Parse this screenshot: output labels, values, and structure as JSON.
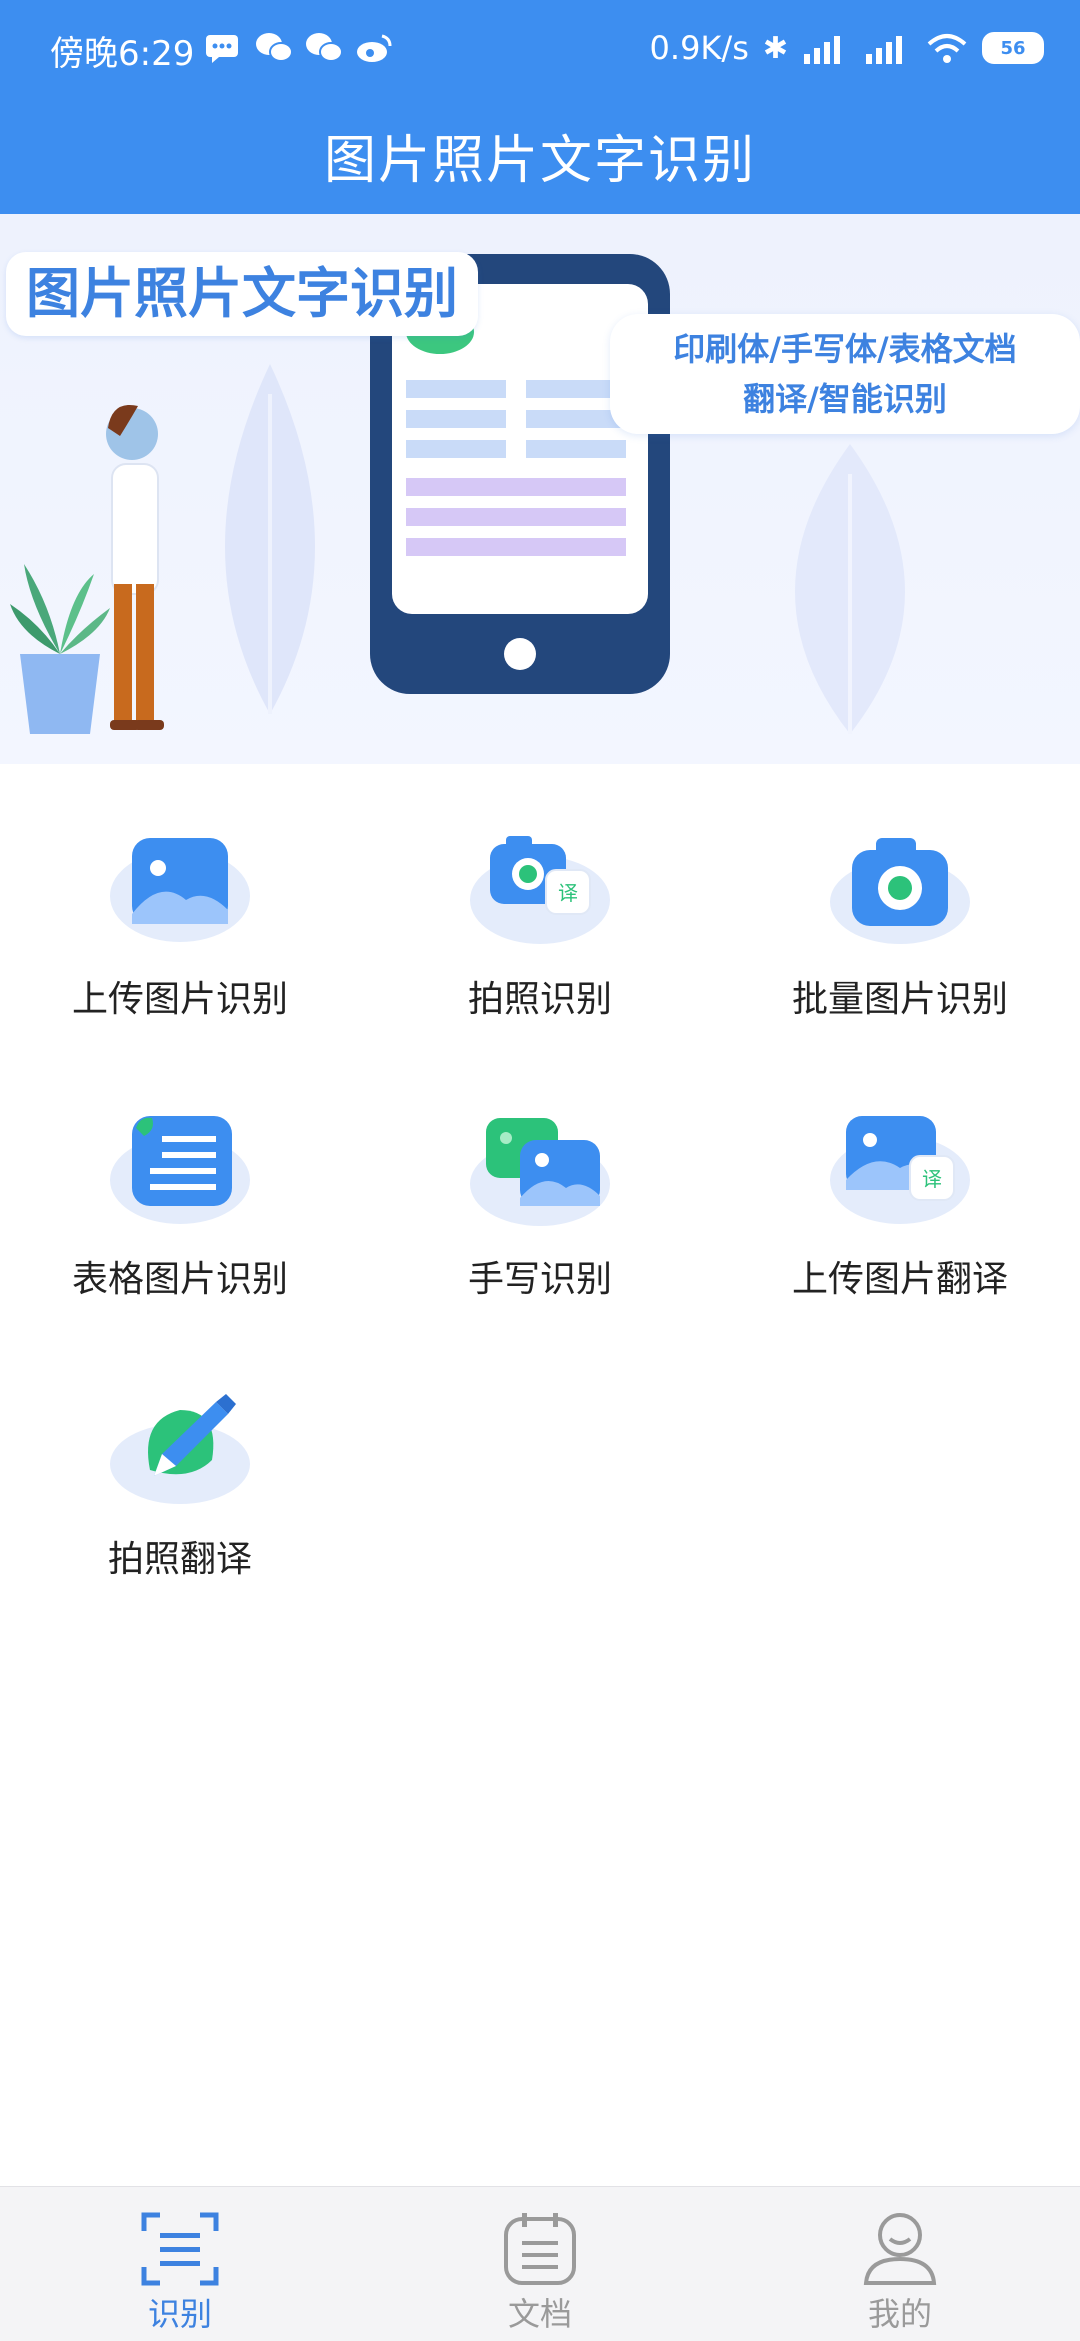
{
  "status": {
    "time": "傍晚6:29",
    "speed": "0.9K/s",
    "battery": "56",
    "notification_icons": [
      "message-icon",
      "wechat-icon",
      "wechat-icon",
      "weibo-icon"
    ]
  },
  "header": {
    "title": "图片照片文字识别"
  },
  "banner": {
    "title": "图片照片文字识别",
    "subtitle_line1": "印刷体/手写体/表格文档",
    "subtitle_line2": "翻译/智能识别"
  },
  "features": [
    {
      "label": "上传图片识别",
      "icon": "image-upload-icon"
    },
    {
      "label": "拍照识别",
      "icon": "camera-translate-icon"
    },
    {
      "label": "批量图片识别",
      "icon": "camera-icon"
    },
    {
      "label": "表格图片识别",
      "icon": "table-document-icon"
    },
    {
      "label": "手写识别",
      "icon": "handwriting-icon"
    },
    {
      "label": "上传图片翻译",
      "icon": "image-translate-icon"
    },
    {
      "label": "拍照翻译",
      "icon": "pen-translate-icon"
    }
  ],
  "nav": [
    {
      "label": "识别",
      "icon": "scan-icon",
      "active": true
    },
    {
      "label": "文档",
      "icon": "document-icon",
      "active": false
    },
    {
      "label": "我的",
      "icon": "profile-icon",
      "active": false
    }
  ],
  "colors": {
    "primary": "#3d8ef0",
    "nav_active": "#3d82e0",
    "nav_inactive": "#9a9a9a",
    "green": "#2cc27a"
  }
}
